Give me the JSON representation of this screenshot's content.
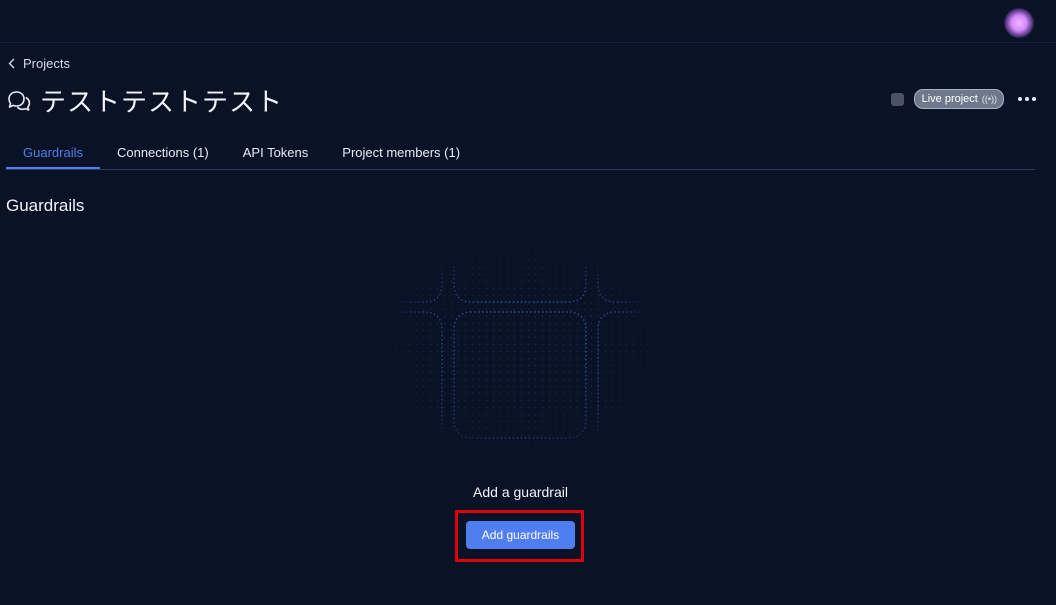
{
  "breadcrumb": {
    "label": "Projects",
    "icon": "chevron-left-icon"
  },
  "project": {
    "title": "テストテストテスト",
    "icon": "chat-bubbles-icon"
  },
  "header": {
    "live_badge": "Live project",
    "live_icon": "radio-waves-icon",
    "more_icon": "more-horizontal-icon"
  },
  "tabs": [
    {
      "label": "Guardrails",
      "active": true
    },
    {
      "label": "Connections (1)",
      "active": false
    },
    {
      "label": "API Tokens",
      "active": false
    },
    {
      "label": "Project members (1)",
      "active": false
    }
  ],
  "section": {
    "title": "Guardrails"
  },
  "empty_state": {
    "message": "Add a guardrail",
    "button_label": "Add guardrails",
    "illustration_icon": "grid-placeholder-icon"
  },
  "colors": {
    "background": "#0a1226",
    "accent": "#4f7ef0",
    "highlight": "#e0000a",
    "badge": "#6e7a8c"
  }
}
